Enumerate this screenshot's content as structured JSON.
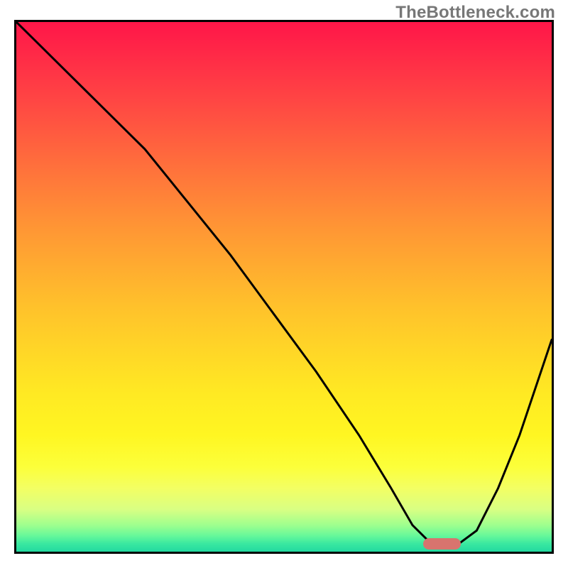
{
  "watermark": "TheBottleneck.com",
  "chart_data": {
    "type": "line",
    "title": "",
    "xlabel": "",
    "ylabel": "",
    "xlim": [
      0,
      1
    ],
    "ylim": [
      0,
      1
    ],
    "grid": false,
    "legend": false,
    "background": {
      "type": "vertical-gradient",
      "stops": [
        {
          "pos": 0.0,
          "color": "#ff1648"
        },
        {
          "pos": 0.5,
          "color": "#ffb22c"
        },
        {
          "pos": 0.8,
          "color": "#fff622"
        },
        {
          "pos": 0.95,
          "color": "#9eff8e"
        },
        {
          "pos": 1.0,
          "color": "#22d9a0"
        }
      ]
    },
    "series": [
      {
        "name": "bottleneck-curve",
        "x": [
          0.0,
          0.04,
          0.1,
          0.17,
          0.24,
          0.32,
          0.4,
          0.48,
          0.56,
          0.64,
          0.7,
          0.74,
          0.78,
          0.82,
          0.86,
          0.9,
          0.94,
          1.0
        ],
        "y": [
          1.0,
          0.96,
          0.9,
          0.83,
          0.76,
          0.66,
          0.56,
          0.45,
          0.34,
          0.22,
          0.12,
          0.05,
          0.01,
          0.01,
          0.04,
          0.12,
          0.22,
          0.4
        ]
      }
    ],
    "marker": {
      "name": "optimal-range",
      "x_center": 0.795,
      "y": 0.015,
      "width": 0.07,
      "color": "#d8746e"
    }
  }
}
